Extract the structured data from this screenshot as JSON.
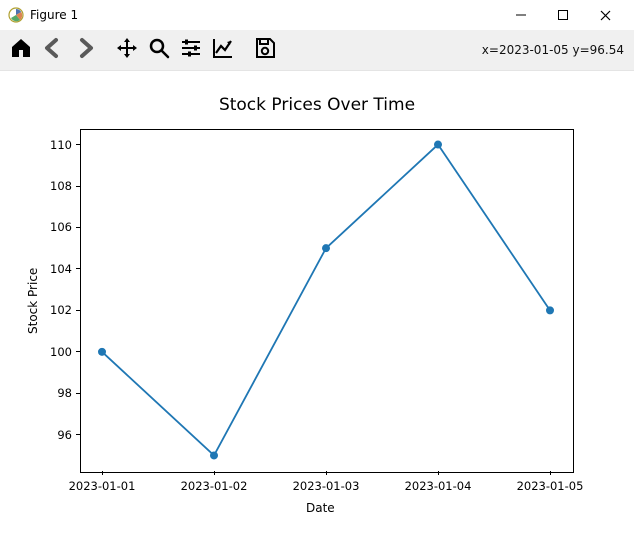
{
  "window": {
    "title": "Figure 1"
  },
  "toolbar": {
    "coord_readout": "x=2023-01-05 y=96.54"
  },
  "chart_data": {
    "type": "line",
    "title": "Stock Prices Over Time",
    "xlabel": "Date",
    "ylabel": "Stock Price",
    "categories": [
      "2023-01-01",
      "2023-01-02",
      "2023-01-03",
      "2023-01-04",
      "2023-01-05"
    ],
    "values": [
      100,
      95,
      105,
      110,
      102
    ],
    "yticks": [
      96,
      98,
      100,
      102,
      104,
      106,
      108,
      110
    ],
    "ylim": [
      94.25,
      110.75
    ],
    "line_color": "#1f77b4",
    "marker": "o"
  }
}
